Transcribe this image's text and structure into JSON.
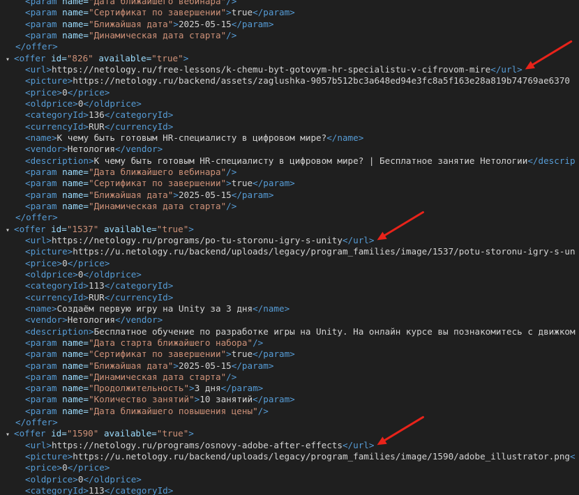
{
  "lines": [
    {
      "kind": "param",
      "name": "Дата ближайшего вебинара",
      "value": ""
    },
    {
      "kind": "param",
      "name": "Сертификат по завершении",
      "value": "true"
    },
    {
      "kind": "param",
      "name": "Ближайшая дата",
      "value": "2025-05-15"
    },
    {
      "kind": "param",
      "name": "Динамическая дата старта",
      "value": ""
    },
    {
      "kind": "close"
    },
    {
      "kind": "open",
      "id": "826",
      "available": "true"
    },
    {
      "kind": "el",
      "tag": "url",
      "text": "https://netology.ru/free-lessons/k-chemu-byt-gotovym-hr-specialistu-v-cifrovom-mire"
    },
    {
      "kind": "el",
      "tag": "picture",
      "text": "https://netology.ru/backend/assets/zaglushka-9057b512bc3a648ed94e3fc8a5f163e28a819b74769ae6370",
      "cut": true
    },
    {
      "kind": "el",
      "tag": "price",
      "text": "0"
    },
    {
      "kind": "el",
      "tag": "oldprice",
      "text": "0"
    },
    {
      "kind": "el",
      "tag": "categoryId",
      "text": "136"
    },
    {
      "kind": "el",
      "tag": "currencyId",
      "text": "RUR"
    },
    {
      "kind": "el",
      "tag": "name",
      "text": "К чему быть готовым HR-специалисту в цифровом мире?"
    },
    {
      "kind": "el",
      "tag": "vendor",
      "text": "Нетология"
    },
    {
      "kind": "el",
      "tag": "description",
      "text": "К чему быть готовым HR-специалисту в цифровом мире? | Бесплатное занятие Нетологии",
      "closeText": "</descrip"
    },
    {
      "kind": "param",
      "name": "Дата ближайшего вебинара",
      "value": ""
    },
    {
      "kind": "param",
      "name": "Сертификат по завершении",
      "value": "true"
    },
    {
      "kind": "param",
      "name": "Ближайшая дата",
      "value": "2025-05-15"
    },
    {
      "kind": "param",
      "name": "Динамическая дата старта",
      "value": ""
    },
    {
      "kind": "close"
    },
    {
      "kind": "open",
      "id": "1537",
      "available": "true"
    },
    {
      "kind": "el",
      "tag": "url",
      "text": "https://netology.ru/programs/po-tu-storonu-igry-s-unity"
    },
    {
      "kind": "el",
      "tag": "picture",
      "text": "https://u.netology.ru/backend/uploads/legacy/program_families/image/1537/potu-storonu-igry-s-un",
      "cut": true
    },
    {
      "kind": "el",
      "tag": "price",
      "text": "0"
    },
    {
      "kind": "el",
      "tag": "oldprice",
      "text": "0"
    },
    {
      "kind": "el",
      "tag": "categoryId",
      "text": "113"
    },
    {
      "kind": "el",
      "tag": "currencyId",
      "text": "RUR"
    },
    {
      "kind": "el",
      "tag": "name",
      "text": "Создаём первую игру на Unity за 3 дня"
    },
    {
      "kind": "el",
      "tag": "vendor",
      "text": "Нетология"
    },
    {
      "kind": "el",
      "tag": "description",
      "text": "Бесплатное обучение по разработке игры на Unity. На онлайн курсе вы познакомитесь с движком",
      "cut": true
    },
    {
      "kind": "param",
      "name": "Дата старта ближайшего набора",
      "value": ""
    },
    {
      "kind": "param",
      "name": "Сертификат по завершении",
      "value": "true"
    },
    {
      "kind": "param",
      "name": "Ближайшая дата",
      "value": "2025-05-15"
    },
    {
      "kind": "param",
      "name": "Динамическая дата старта",
      "value": ""
    },
    {
      "kind": "param",
      "name": "Продолжительность",
      "value": "3 дня"
    },
    {
      "kind": "param",
      "name": "Количество занятий",
      "value": "10 занятий"
    },
    {
      "kind": "param",
      "name": "Дата ближайшего повышения цены",
      "value": ""
    },
    {
      "kind": "close"
    },
    {
      "kind": "open",
      "id": "1590",
      "available": "true"
    },
    {
      "kind": "el",
      "tag": "url",
      "text": "https://netology.ru/programs/osnovy-adobe-after-effects"
    },
    {
      "kind": "el",
      "tag": "picture",
      "text": "https://u.netology.ru/backend/uploads/legacy/program_families/image/1590/adobe_illustrator.png",
      "closeText": "<"
    },
    {
      "kind": "el",
      "tag": "price",
      "text": "0"
    },
    {
      "kind": "el",
      "tag": "oldprice",
      "text": "0"
    },
    {
      "kind": "el",
      "tag": "categoryId",
      "text": "113"
    }
  ],
  "arrows": [
    {
      "target_line": 6,
      "color": "#e8231a"
    },
    {
      "target_line": 21,
      "color": "#e8231a"
    },
    {
      "target_line": 39,
      "color": "#e8231a"
    }
  ],
  "colors": {
    "background": "#1f1f1f",
    "tag": "#569cd6",
    "attribute": "#9cdcfe",
    "value": "#ce9178",
    "text": "#d4d4d4",
    "annotation": "#e8231a"
  }
}
